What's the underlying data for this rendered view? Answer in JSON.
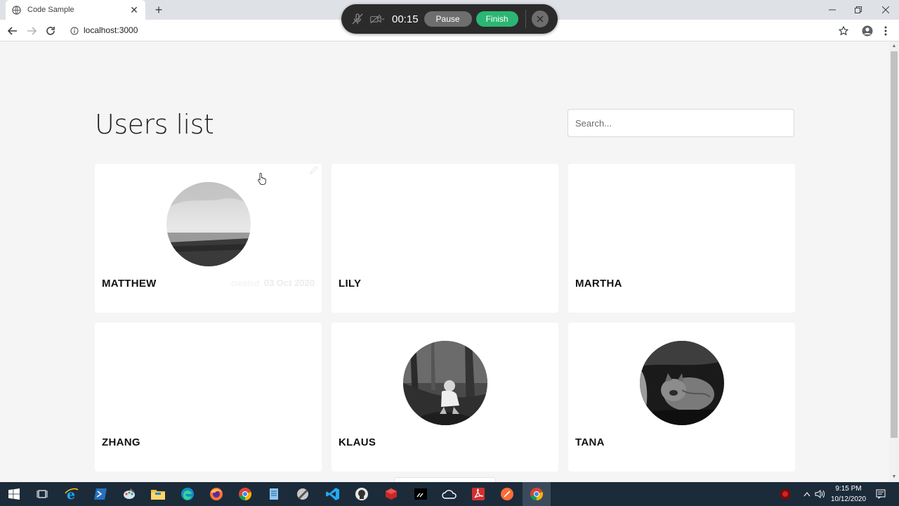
{
  "browser": {
    "tab_title": "Code Sample",
    "tab_close": "✕",
    "new_tab": "+",
    "url": "localhost:3000",
    "window_controls": [
      "minimize",
      "restore",
      "close"
    ]
  },
  "recorder": {
    "time": "00:15",
    "pause_label": "Pause",
    "finish_label": "Finish",
    "pause_color": "#6e6e6e",
    "finish_color": "#2bb673"
  },
  "page": {
    "title": "Users list",
    "search_placeholder": "Search..."
  },
  "users": [
    {
      "name": "MATTHEW",
      "created_label": "created:",
      "created_date": "03 Oct 2020",
      "photo": "seascape-photo",
      "has_photo": true
    },
    {
      "name": "LILY",
      "has_photo": false
    },
    {
      "name": "MARTHA",
      "has_photo": false
    },
    {
      "name": "ZHANG",
      "has_photo": false
    },
    {
      "name": "KLAUS",
      "photo": "child-in-forest-photo",
      "has_photo": true
    },
    {
      "name": "TANA",
      "photo": "cat-photo",
      "has_photo": true
    }
  ],
  "taskbar": {
    "apps": [
      "start-icon",
      "task-view-icon",
      "internet-explorer-icon",
      "powershell-icon",
      "paint-icon",
      "file-explorer-icon",
      "edge-icon",
      "firefox-icon",
      "chrome-icon",
      "notepad-icon",
      "inkscape-icon",
      "vscode-icon",
      "github-desktop-icon",
      "package-icon",
      "terminal-icon",
      "onedrive-icon",
      "acrobat-icon",
      "postman-icon",
      "chrome-active-icon"
    ],
    "time": "9:15 PM",
    "date": "10/12/2020"
  },
  "colors": {
    "page_bg": "#f5f5f5",
    "card_bg": "#ffffff",
    "taskbar_bg": "#1c2b3a"
  }
}
